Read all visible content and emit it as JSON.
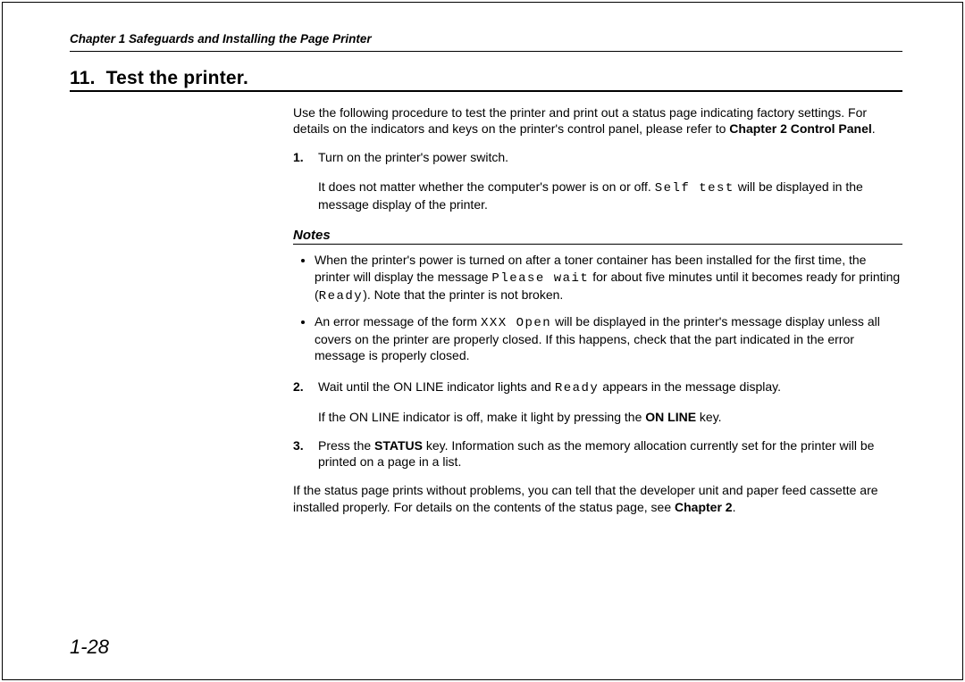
{
  "header": {
    "running": "Chapter 1 Safeguards and Installing the Page Printer"
  },
  "section": {
    "number": "11.",
    "title": "Test the printer."
  },
  "intro": {
    "p1a": "Use the following procedure to test the printer and print out a status page indicating factory settings. For details on the indicators and keys on the printer's control panel, please refer to ",
    "p1b": "Chapter 2 Control Panel",
    "p1c": "."
  },
  "steps": {
    "s1": {
      "num": "1.",
      "line1": "Turn on the printer's power switch.",
      "line2a": "It does not matter whether the computer's power is on or off. ",
      "line2b_mono": "Self test",
      "line2c": " will be displayed in the message display of the printer."
    },
    "s2": {
      "num": "2.",
      "line1a": "Wait until the ON LINE indicator lights and ",
      "line1b_mono": "Ready",
      "line1c": " appears in the message display.",
      "line2a": "If the ON LINE indicator is off, make it light by pressing the ",
      "line2b_bold": "ON LINE",
      "line2c": " key."
    },
    "s3": {
      "num": "3.",
      "line1a": "Press the ",
      "line1b_bold": "STATUS",
      "line1c": " key.  Information such as the memory allocation currently set for the printer will be printed on a page in a list."
    }
  },
  "notes": {
    "heading": "Notes",
    "n1": {
      "a": "When the printer's power is turned on after a toner container has been installed for the first time, the printer will display the message ",
      "b_mono": "Please wait",
      "c": " for about five minutes until it becomes ready for printing (",
      "d_mono": "Ready",
      "e": ").  Note that the printer is not broken."
    },
    "n2": {
      "a": "An error message of the form ",
      "b_mono": "XXX Open",
      "c": " will be displayed in the printer's message display unless all covers on the printer are properly closed.  If this happens, check that the part indicated in the error message is properly closed."
    }
  },
  "closing": {
    "a": "If the status page prints without problems, you can tell that the developer unit and paper feed cassette are installed properly.  For details on the contents of the status page, see ",
    "b_bold": "Chapter 2",
    "c": "."
  },
  "page_number": "1-28"
}
